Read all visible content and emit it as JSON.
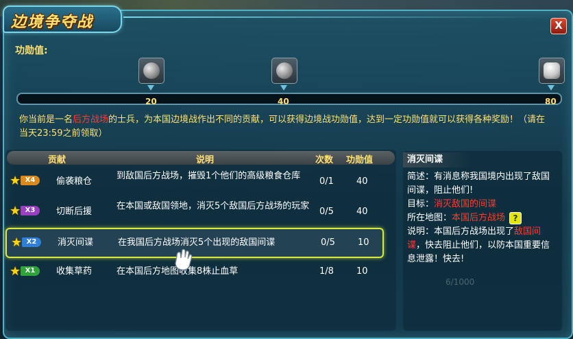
{
  "window": {
    "title": "边境争夺战",
    "close_label": "X"
  },
  "merit": {
    "label": "功勋值:",
    "marks": [
      {
        "value": "20",
        "reward_icon": "silver-orb-icon"
      },
      {
        "value": "40",
        "reward_icon": "silver-orb-icon"
      },
      {
        "value": "80",
        "reward_icon": "treasure-chest-icon"
      }
    ]
  },
  "intro": {
    "part1": "你当前是一名",
    "role": "后方战场",
    "part2": "的士兵，为本国边境战作出不同的贡献，可以获得边境战功勋值，达到一定功勋值就可以获得各种奖励！（请在当天23:59之前领取）"
  },
  "table": {
    "headers": {
      "contribution": "贡献",
      "description": "说明",
      "count": "次数",
      "merit": "功勋值"
    },
    "rows": [
      {
        "multiplier": "X4",
        "badge_color": "#d98a1a",
        "name": "偷袭粮仓",
        "description": "到敌国后方战场，摧毁1个他们的高级粮食仓库",
        "count": "0/1",
        "merit": "40",
        "selected": false
      },
      {
        "multiplier": "X3",
        "badge_color": "#9b3fc2",
        "name": "切断后援",
        "description": "在本国或敌国领地，消灭5个敌国后方战场的玩家",
        "count": "0/5",
        "merit": "40",
        "selected": false
      },
      {
        "multiplier": "X2",
        "badge_color": "#2f7fd6",
        "name": "消灭间谍",
        "description": "在我国后方战场消灭5个出现的敌国间谍",
        "count": "0/5",
        "merit": "10",
        "selected": true
      },
      {
        "multiplier": "X1",
        "badge_color": "#2fa43a",
        "name": "收集草药",
        "description": "在本国后方地图收集8株止血草",
        "count": "1/8",
        "merit": "10",
        "selected": false
      }
    ]
  },
  "detail": {
    "tab_label": "消灭间谍",
    "summary_label": "简述：",
    "summary": "有消息称我国境内出现了敌国间谍，阻止他们!",
    "target_label": "目标：",
    "target": "消灭敌国的间谍",
    "map_label": "所在地图：",
    "map": "本国后方战场",
    "help_icon": "?",
    "note_label": "说明：",
    "note_part1": "本国后方战场出现了",
    "note_highlight": "敌国间谍",
    "note_part2": "，快去阻止他们，以防本国重要信息泄露！快去!"
  },
  "background_text": {
    "hp_readout": "6/1000"
  },
  "colors": {
    "accent_yellow": "#ffe070",
    "highlight_red": "#ff3b2f",
    "selection": "#d9ea3a"
  }
}
